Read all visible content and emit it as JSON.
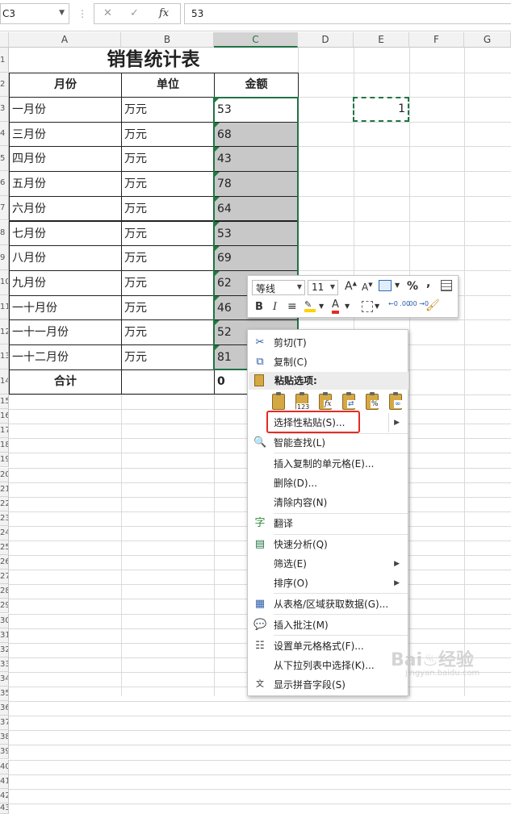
{
  "formula_bar": {
    "name_box": "C3",
    "fx_label": "fx",
    "value": "53"
  },
  "columns": [
    "A",
    "B",
    "C",
    "D",
    "E",
    "F",
    "G"
  ],
  "row_numbers": [
    "1",
    "2",
    "3",
    "4",
    "5",
    "6",
    "7",
    "8",
    "9",
    "10",
    "11",
    "12",
    "13",
    "14",
    "15",
    "16",
    "17",
    "18",
    "19",
    "20",
    "21",
    "22",
    "23",
    "24",
    "25",
    "26",
    "27",
    "28",
    "29",
    "30",
    "31",
    "32",
    "33",
    "34",
    "35",
    "36",
    "37",
    "38",
    "39",
    "40",
    "41",
    "42",
    "43"
  ],
  "sheet": {
    "title": "销售统计表",
    "headers": {
      "month": "月份",
      "unit": "单位",
      "amount": "金额"
    },
    "rows": [
      {
        "month": "一月份",
        "unit": "万元",
        "amount": "53"
      },
      {
        "month": "三月份",
        "unit": "万元",
        "amount": "68"
      },
      {
        "month": "四月份",
        "unit": "万元",
        "amount": "43"
      },
      {
        "month": "五月份",
        "unit": "万元",
        "amount": "78"
      },
      {
        "month": "六月份",
        "unit": "万元",
        "amount": "64"
      },
      {
        "month": "七月份",
        "unit": "万元",
        "amount": "53"
      },
      {
        "month": "八月份",
        "unit": "万元",
        "amount": "69"
      },
      {
        "month": "九月份",
        "unit": "万元",
        "amount": "62"
      },
      {
        "month": "一十月份",
        "unit": "万元",
        "amount": "46"
      },
      {
        "month": "一十一月份",
        "unit": "万元",
        "amount": "52"
      },
      {
        "month": "一十二月份",
        "unit": "万元",
        "amount": "81"
      }
    ],
    "total_label": "合计",
    "total_value": "0",
    "copied_cell_value": "1"
  },
  "mini_toolbar": {
    "font": "等线",
    "size": "11",
    "percent": "%",
    "comma": ",",
    "bold": "B",
    "italic": "I",
    "font_color_letter": "A",
    "inc_decimal": "←0 .00",
    "dec_decimal": ".00 →0"
  },
  "context_menu": {
    "cut": "剪切(T)",
    "copy": "复制(C)",
    "paste_options": "粘贴选项:",
    "paste_special": "选择性粘贴(S)...",
    "smart_lookup": "智能查找(L)",
    "insert_copied": "插入复制的单元格(E)...",
    "delete": "删除(D)...",
    "clear": "清除内容(N)",
    "translate": "翻译",
    "quick_analysis": "快速分析(Q)",
    "filter": "筛选(E)",
    "sort": "排序(O)",
    "from_table": "从表格/区域获取数据(G)...",
    "insert_comment": "插入批注(M)",
    "format_cells": "设置单元格格式(F)...",
    "pick_list": "从下拉列表中选择(K)...",
    "phonetic": "显示拼音字段(S)"
  },
  "colors": {
    "excel_green": "#217346",
    "highlight_red": "#e52b25",
    "selection_gray": "#c8c8c8"
  }
}
